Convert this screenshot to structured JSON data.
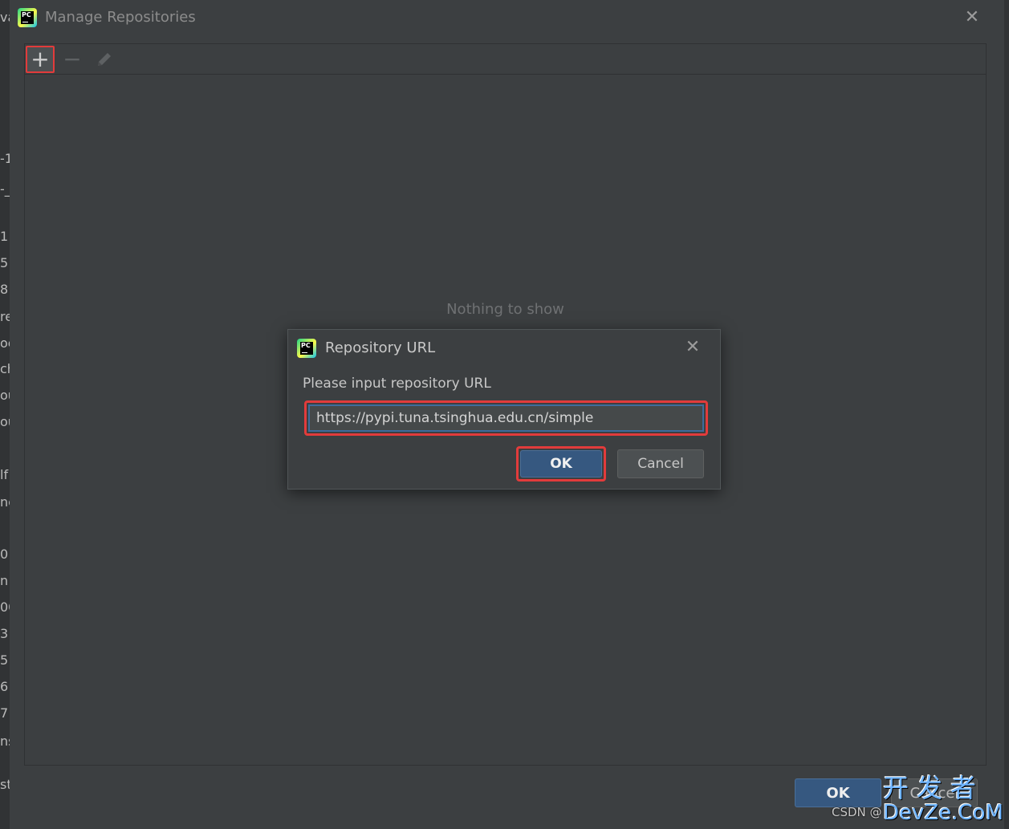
{
  "main_dialog": {
    "title": "Manage Repositories",
    "toolbar": {
      "add_label": "+",
      "remove_label": "−"
    },
    "empty_text": "Nothing to show",
    "ok_label": "OK",
    "cancel_label": "Cancel"
  },
  "repo_dialog": {
    "title": "Repository URL",
    "prompt": "Please input repository URL",
    "url_value": "https://pypi.tuna.tsinghua.edu.cn/simple",
    "ok_label": "OK",
    "cancel_label": "Cancel"
  },
  "app_icon_text": "PC",
  "background_fragments": [
    "va",
    "-1",
    "-_",
    "1",
    "5",
    "8",
    "re",
    "oc",
    "ch",
    "ou",
    "ou",
    "lf",
    "nc",
    "0",
    "n",
    "00",
    "3",
    "5",
    "6",
    "7",
    "ns",
    "st"
  ],
  "watermark": {
    "csdn": "CSDN @",
    "cn": "开发者",
    "en": "DevZe.CoM"
  },
  "colors": {
    "highlight_red": "#e23b3b",
    "primary_button": "#365880",
    "dialog_bg": "#3c3f41"
  }
}
